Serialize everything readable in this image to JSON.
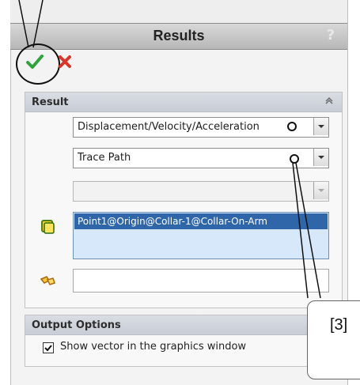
{
  "window": {
    "title": "Results",
    "help_symbol": "?"
  },
  "actions": {
    "ok_icon": "check-icon",
    "cancel_icon": "close-icon"
  },
  "result_section": {
    "label": "Result",
    "collapse_icon": "double-chevron-up-icon",
    "category_value": "Displacement/Velocity/Acceleration",
    "subcategory_value": "Trace Path",
    "third_value": "",
    "selection_item": "Point1@Origin@Collar-1@Collar-On-Arm",
    "empty_field_value": ""
  },
  "output_options": {
    "label": "Output Options",
    "show_vector_label": "Show vector in the graphics window",
    "show_vector_checked": true
  },
  "callout": {
    "label": "[3]"
  },
  "colors": {
    "accent": "#2f66a9",
    "ok": "#2fa43c",
    "cancel": "#d9352a"
  }
}
